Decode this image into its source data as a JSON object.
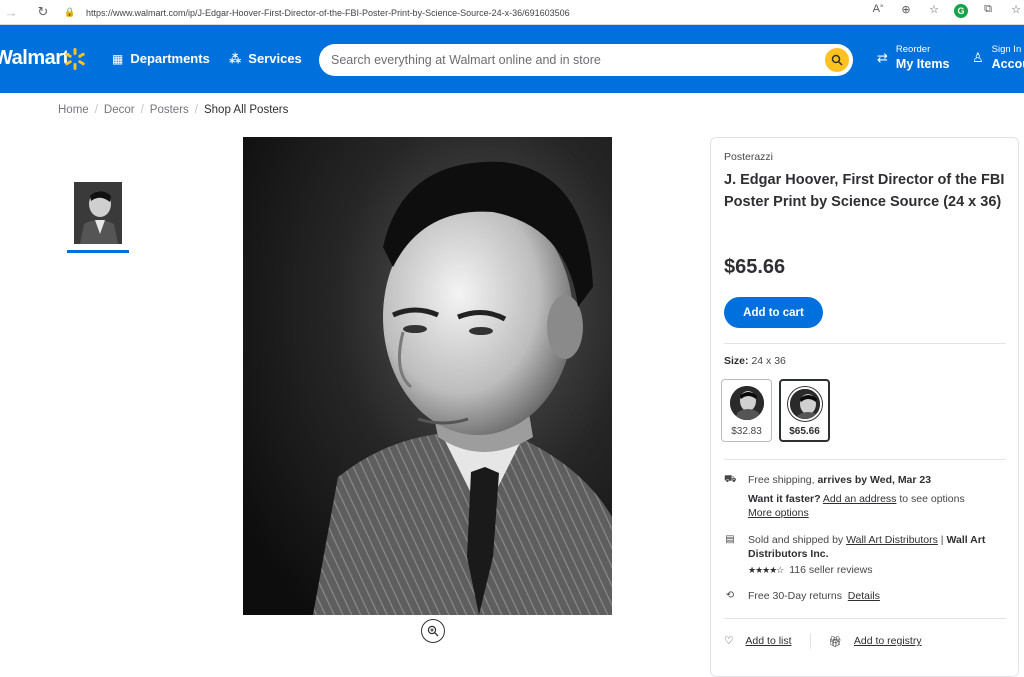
{
  "browser": {
    "url": "https://www.walmart.com/ip/J-Edgar-Hoover-First-Director-of-the-FBI-Poster-Print-by-Science-Source-24-x-36/691603506"
  },
  "header": {
    "logo": "Walmart",
    "departments_label": "Departments",
    "services_label": "Services",
    "search_placeholder": "Search everything at Walmart online and in store",
    "reorder_small": "Reorder",
    "reorder_big": "My Items",
    "signin_small": "Sign In",
    "signin_big": "Account",
    "brand_color": "#0071dc",
    "spark_color": "#ffc220"
  },
  "breadcrumb": [
    "Home",
    "Decor",
    "Posters",
    "Shop All Posters"
  ],
  "product": {
    "brand": "Posterazzi",
    "title": "J. Edgar Hoover, First Director of the FBI Poster Print by Science Source (24 x 36)",
    "price": "$65.66",
    "add_to_cart": "Add to cart",
    "size_label": "Size:",
    "size_value": "24 x 36",
    "options": [
      {
        "price": "$32.83",
        "selected": false
      },
      {
        "price": "$65.66",
        "selected": true
      }
    ],
    "shipping": {
      "prefix": "Free shipping,",
      "arrival": "arrives by Wed, Mar 23",
      "faster_q": "Want it faster?",
      "add_address": "Add an address",
      "see_options": "to see options",
      "more_options": "More options"
    },
    "seller": {
      "prefix": "Sold and shipped by",
      "name_link": "Wall Art Distributors",
      "sep": "|",
      "name_bold": "Wall Art Distributors Inc.",
      "rating": 4,
      "reviews": "116 seller reviews"
    },
    "returns": {
      "text": "Free 30-Day returns",
      "details": "Details"
    },
    "add_to_list": "Add to list",
    "add_to_registry": "Add to registry"
  }
}
